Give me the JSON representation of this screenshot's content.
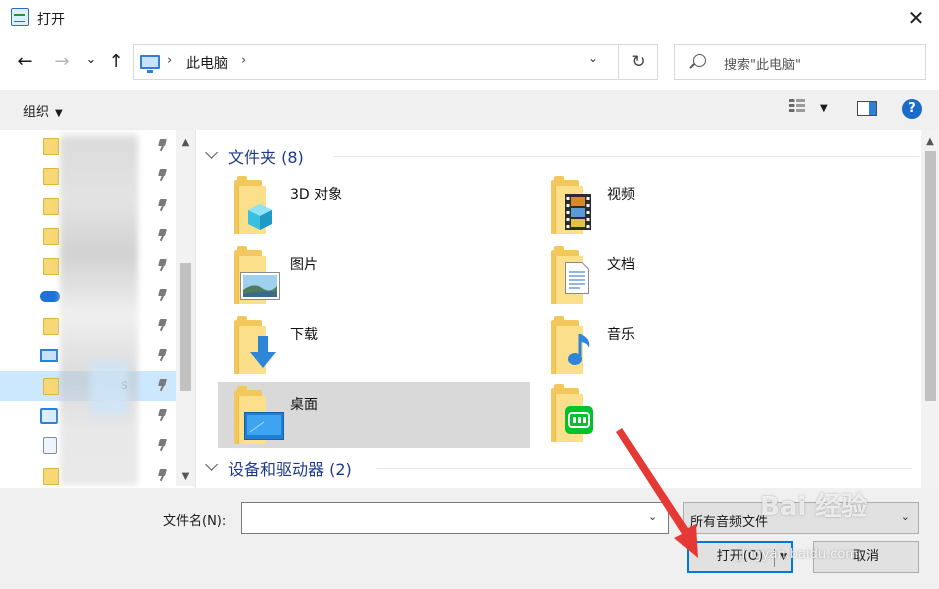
{
  "window": {
    "title": "打开",
    "close_glyph": "✕"
  },
  "nav": {
    "back": "←",
    "forward": "→",
    "recent": "⌄",
    "up": "↑",
    "address_path": "此电脑",
    "address_sep": "›",
    "address_dropdown": "⌄",
    "refresh": "↻",
    "search_placeholder": "搜索\"此电脑\""
  },
  "toolbar": {
    "organize_label": "组织",
    "organize_caret": "▼",
    "view_caret": "▼",
    "help": "?"
  },
  "sidebar": {
    "items": [
      {
        "icon": "folder-icon",
        "label": "",
        "pinned": true
      },
      {
        "icon": "folder-icon",
        "label": "",
        "pinned": true
      },
      {
        "icon": "folder-icon",
        "label": "",
        "pinned": true
      },
      {
        "icon": "folder-icon",
        "label": "",
        "pinned": true
      },
      {
        "icon": "folder-icon",
        "label": "",
        "pinned": true
      },
      {
        "icon": "onedrive-icon",
        "label": "",
        "pinned": true
      },
      {
        "icon": "folder-icon",
        "label": "",
        "pinned": true
      },
      {
        "icon": "pc-icon",
        "label": "",
        "pinned": true
      },
      {
        "icon": "folder-icon",
        "label": "s",
        "pinned": true,
        "selected": true
      },
      {
        "icon": "network-icon",
        "label": "",
        "pinned": true
      },
      {
        "icon": "recycle-bin-icon",
        "label": "",
        "pinned": true
      },
      {
        "icon": "folder-icon",
        "label": "",
        "pinned": true
      }
    ],
    "scroll_up": "▲",
    "scroll_down": "▼"
  },
  "main": {
    "groups": [
      {
        "title": "文件夹 (8)"
      },
      {
        "title": "设备和驱动器 (2)"
      }
    ],
    "folders": [
      {
        "label": "3D 对象",
        "overlay": "cube-icon"
      },
      {
        "label": "视频",
        "overlay": "film-icon"
      },
      {
        "label": "图片",
        "overlay": "picture-icon"
      },
      {
        "label": "文档",
        "overlay": "document-icon"
      },
      {
        "label": "下载",
        "overlay": "download-arrow-icon"
      },
      {
        "label": "音乐",
        "overlay": "music-note-icon"
      },
      {
        "label": "桌面",
        "overlay": "desktop-icon",
        "selected": true
      },
      {
        "label": "",
        "overlay": "iqiyi-icon"
      }
    ],
    "scroll_up": "▲"
  },
  "bottom": {
    "filename_label": "文件名(N):",
    "filename_value": "",
    "filename_dropdown": "⌄",
    "filetype_value": "所有音频文件",
    "filetype_dropdown": "⌄",
    "open_button": "打开(O)",
    "open_caret": "▼",
    "cancel_button": "取消"
  },
  "watermark": {
    "text": "Bai 经验",
    "url": "jingyan.baidu.com"
  },
  "colors": {
    "accent": "#0078d7",
    "selection": "#cce8ff",
    "group_title": "#1e3a8a",
    "folder": "#f2c85e",
    "annotation_arrow": "#e53935"
  }
}
